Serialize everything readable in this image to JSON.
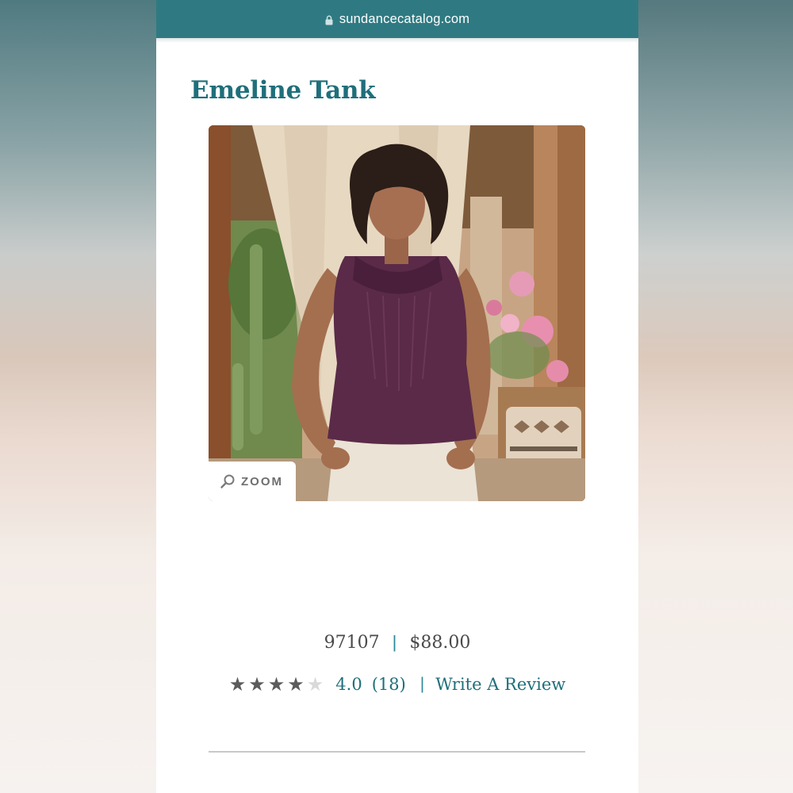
{
  "browser": {
    "url": "sundancecatalog.com",
    "lock_icon": "lock-icon"
  },
  "product": {
    "title": "Emeline Tank",
    "item_number": "97107",
    "price": "$88.00",
    "zoom_label": "ZOOM",
    "zoom_icon": "magnifier-icon"
  },
  "rating": {
    "stars_filled": 4,
    "stars_total": 5,
    "value": "4.0",
    "count": "(18)",
    "write_review_label": "Write A Review"
  },
  "colors": {
    "brand_teal": "#2f7a82",
    "title_teal": "#1f6f7a",
    "star_filled": "#5c5c5c",
    "star_empty": "#d9d9d9"
  }
}
